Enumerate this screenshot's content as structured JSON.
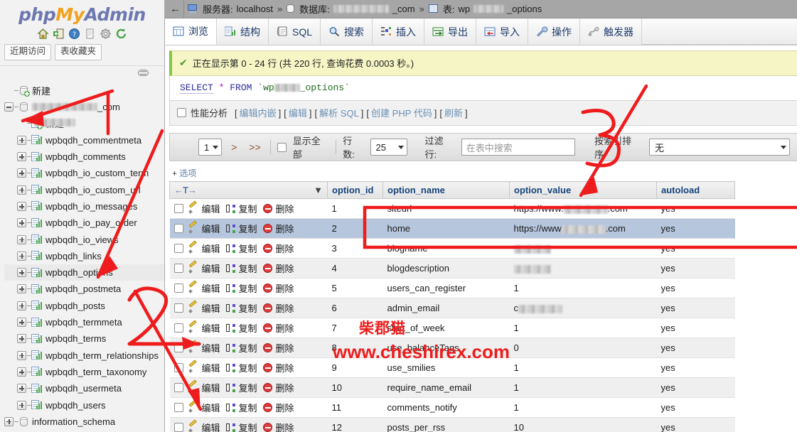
{
  "app": {
    "brand_php": "php",
    "brand_my": "My",
    "brand_admin": "Admin"
  },
  "sidebar": {
    "icons": [
      "home-icon",
      "logout-icon",
      "help-icon",
      "docs-icon",
      "settings-icon",
      "reload-icon"
    ],
    "quick_tabs": [
      {
        "label": "近期访问"
      },
      {
        "label": "表收藏夹"
      }
    ],
    "tree": [
      {
        "label": "新建",
        "type": "new-database",
        "depth": 0,
        "expander": false,
        "selected": false
      },
      {
        "label": "",
        "blurred": true,
        "suffix": "_com",
        "type": "database",
        "depth": 0,
        "expander": "minus",
        "selected": false
      },
      {
        "label": "新建",
        "type": "new-table",
        "depth": 1,
        "expander": false,
        "selected": false,
        "blurred_over": true
      },
      {
        "label": "wpbqdh_commentmeta",
        "type": "table",
        "depth": 1,
        "expander": "plus",
        "selected": false
      },
      {
        "label": "wpbqdh_comments",
        "type": "table",
        "depth": 1,
        "expander": "plus",
        "selected": false
      },
      {
        "label": "wpbqdh_io_custom_term",
        "type": "table",
        "depth": 1,
        "expander": "plus",
        "selected": false
      },
      {
        "label": "wpbqdh_io_custom_url",
        "type": "table",
        "depth": 1,
        "expander": "plus",
        "selected": false
      },
      {
        "label": "wpbqdh_io_messages",
        "type": "table",
        "depth": 1,
        "expander": "plus",
        "selected": false
      },
      {
        "label": "wpbqdh_io_pay_order",
        "type": "table",
        "depth": 1,
        "expander": "plus",
        "selected": false
      },
      {
        "label": "wpbqdh_io_views",
        "type": "table",
        "depth": 1,
        "expander": "plus",
        "selected": false
      },
      {
        "label": "wpbqdh_links",
        "type": "table",
        "depth": 1,
        "expander": "plus",
        "selected": false
      },
      {
        "label": "wpbqdh_options",
        "type": "table",
        "depth": 1,
        "expander": "plus",
        "selected": true
      },
      {
        "label": "wpbqdh_postmeta",
        "type": "table",
        "depth": 1,
        "expander": "plus",
        "selected": false
      },
      {
        "label": "wpbqdh_posts",
        "type": "table",
        "depth": 1,
        "expander": "plus",
        "selected": false
      },
      {
        "label": "wpbqdh_termmeta",
        "type": "table",
        "depth": 1,
        "expander": "plus",
        "selected": false
      },
      {
        "label": "wpbqdh_terms",
        "type": "table",
        "depth": 1,
        "expander": "plus",
        "selected": false
      },
      {
        "label": "wpbqdh_term_relationships",
        "type": "table",
        "depth": 1,
        "expander": "plus",
        "selected": false
      },
      {
        "label": "wpbqdh_term_taxonomy",
        "type": "table",
        "depth": 1,
        "expander": "plus",
        "selected": false
      },
      {
        "label": "wpbqdh_usermeta",
        "type": "table",
        "depth": 1,
        "expander": "plus",
        "selected": false
      },
      {
        "label": "wpbqdh_users",
        "type": "table",
        "depth": 1,
        "expander": "plus",
        "selected": false
      },
      {
        "label": "information_schema",
        "type": "database",
        "depth": 0,
        "expander": "plus",
        "selected": false
      }
    ]
  },
  "breadcrumb": {
    "back_glyph": "←",
    "server_label": "服务器:",
    "server_value": "localhost",
    "sep": "»",
    "db_label": "数据库:",
    "db_value_suffix": "_com",
    "table_label": "表:",
    "table_value_prefix": "wp",
    "table_value_suffix": "_options"
  },
  "tabs": [
    {
      "label": "浏览",
      "icon": "browse-icon",
      "active": true
    },
    {
      "label": "结构",
      "icon": "structure-icon",
      "active": false
    },
    {
      "label": "SQL",
      "icon": "sql-icon",
      "active": false
    },
    {
      "label": "搜索",
      "icon": "search-icon",
      "active": false
    },
    {
      "label": "插入",
      "icon": "insert-icon",
      "active": false
    },
    {
      "label": "导出",
      "icon": "export-icon",
      "active": false
    },
    {
      "label": "导入",
      "icon": "import-icon",
      "active": false
    },
    {
      "label": "操作",
      "icon": "operations-wrench-icon",
      "active": false
    },
    {
      "label": "触发器",
      "icon": "triggers-icon",
      "active": false
    }
  ],
  "status": {
    "check_icon": "check-icon",
    "message": "正在显示第 0 - 24 行 (共 220 行, 查询花费 0.0003 秒。)"
  },
  "query": {
    "select": "SELECT",
    "star": "*",
    "from": "FROM",
    "backtick": "`",
    "table_prefix": "wp",
    "table_suffix": "_options"
  },
  "query_actions": {
    "profiling_label": "性能分析",
    "links": [
      "编辑内嵌",
      "编辑",
      "解析 SQL",
      "创建 PHP 代码",
      "刷新"
    ],
    "bracket_open": "[",
    "bracket_close": "]"
  },
  "pagination": {
    "page_value": "1",
    "next_label": ">",
    "last_label": ">>",
    "show_all_label": "显示全部",
    "rows_label": "行数:",
    "rows_value": "25",
    "filter_label": "过滤行:",
    "filter_placeholder": "在表中搜索",
    "sort_label": "按索引排序:",
    "sort_value": "无"
  },
  "options_toggle": {
    "plus": "+",
    "label": "选项"
  },
  "table": {
    "sort_header": "←T→",
    "columns": [
      "option_id",
      "option_name",
      "option_value",
      "autoload"
    ],
    "row_actions": {
      "edit": "编辑",
      "copy": "复制",
      "delete": "删除"
    },
    "rows": [
      {
        "option_id": "1",
        "option_name": "siteurl",
        "option_value": "https://www.",
        "value_blurred": true,
        "value_tail": ".com",
        "autoload": "yes",
        "highlight": false
      },
      {
        "option_id": "2",
        "option_name": "home",
        "option_value": "https://www",
        "value_blurred": true,
        "value_tail": ".com",
        "autoload": "yes",
        "highlight": true
      },
      {
        "option_id": "3",
        "option_name": "blogname",
        "option_value": "",
        "value_blurred": true,
        "value_tail": "",
        "autoload": "yes",
        "highlight": false
      },
      {
        "option_id": "4",
        "option_name": "blogdescription",
        "option_value": "",
        "value_blurred": true,
        "value_tail": "",
        "autoload": "yes",
        "highlight": false
      },
      {
        "option_id": "5",
        "option_name": "users_can_register",
        "option_value": "1",
        "value_blurred": false,
        "value_tail": "",
        "autoload": "yes",
        "highlight": false
      },
      {
        "option_id": "6",
        "option_name": "admin_email",
        "option_value": "c",
        "value_blurred": true,
        "value_tail": "",
        "autoload": "yes",
        "highlight": false
      },
      {
        "option_id": "7",
        "option_name": "start_of_week",
        "option_value": "1",
        "value_blurred": false,
        "value_tail": "",
        "autoload": "yes",
        "highlight": false
      },
      {
        "option_id": "8",
        "option_name": "use_balanceTags",
        "option_value": "0",
        "value_blurred": false,
        "value_tail": "",
        "autoload": "yes",
        "highlight": false
      },
      {
        "option_id": "9",
        "option_name": "use_smilies",
        "option_value": "1",
        "value_blurred": false,
        "value_tail": "",
        "autoload": "yes",
        "highlight": false
      },
      {
        "option_id": "10",
        "option_name": "require_name_email",
        "option_value": "1",
        "value_blurred": false,
        "value_tail": "",
        "autoload": "yes",
        "highlight": false
      },
      {
        "option_id": "11",
        "option_name": "comments_notify",
        "option_value": "1",
        "value_blurred": false,
        "value_tail": "",
        "autoload": "yes",
        "highlight": false
      },
      {
        "option_id": "12",
        "option_name": "posts_per_rss",
        "option_value": "10",
        "value_blurred": false,
        "value_tail": "",
        "autoload": "yes",
        "highlight": false
      }
    ]
  },
  "annotations": {
    "color": "#ee1c1c",
    "marks": [
      {
        "name": "number-2",
        "text": "2"
      },
      {
        "name": "number-3",
        "text": "3"
      }
    ]
  },
  "watermark": {
    "cn": "柴郡猫",
    "url": "www.cheshirex.com",
    "color": "#ee1c1c"
  }
}
